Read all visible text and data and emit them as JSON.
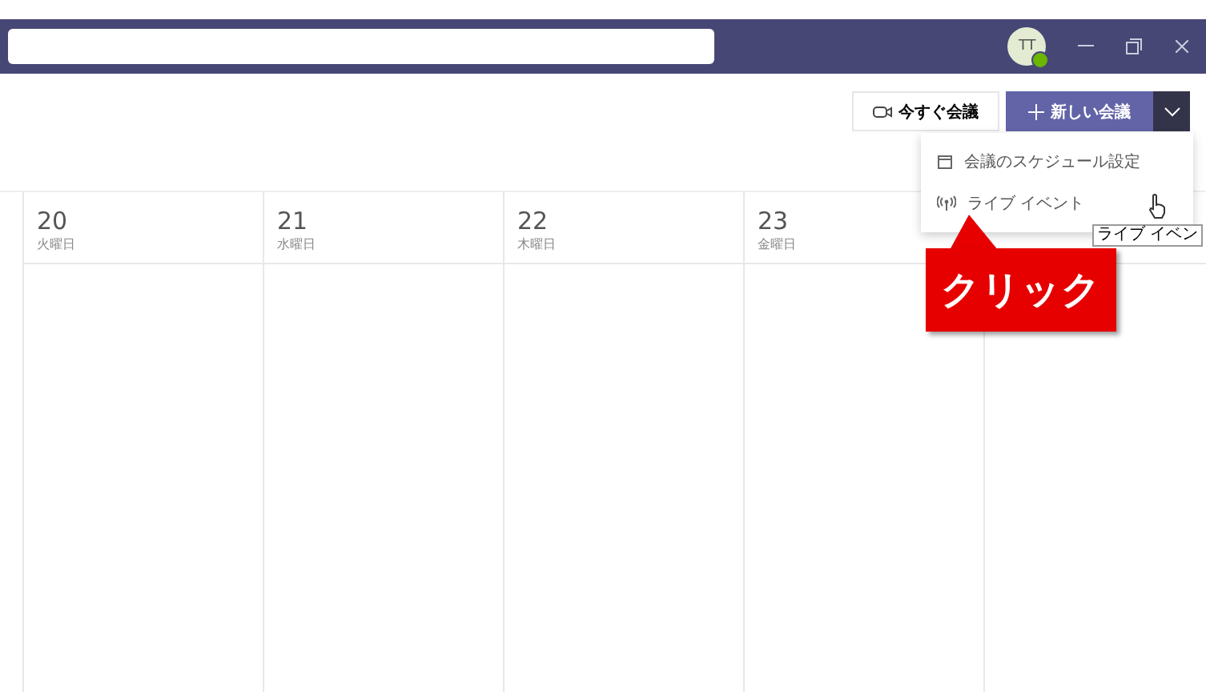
{
  "title_bar": {
    "avatar": "TT",
    "online": true
  },
  "toolbar": {
    "meet_now": "今すぐ会議",
    "new_meeting": "新しい会議"
  },
  "menu": {
    "items": [
      {
        "kind": "schedule",
        "label": "会議のスケジュール設定"
      },
      {
        "kind": "live",
        "label": "ライブ イベント"
      }
    ]
  },
  "tooltip": "ライブ イベン",
  "callout": "クリック",
  "days": [
    {
      "date": "20",
      "weekday": "火曜日"
    },
    {
      "date": "21",
      "weekday": "水曜日"
    },
    {
      "date": "22",
      "weekday": "木曜日"
    },
    {
      "date": "23",
      "weekday": "金曜日"
    }
  ]
}
